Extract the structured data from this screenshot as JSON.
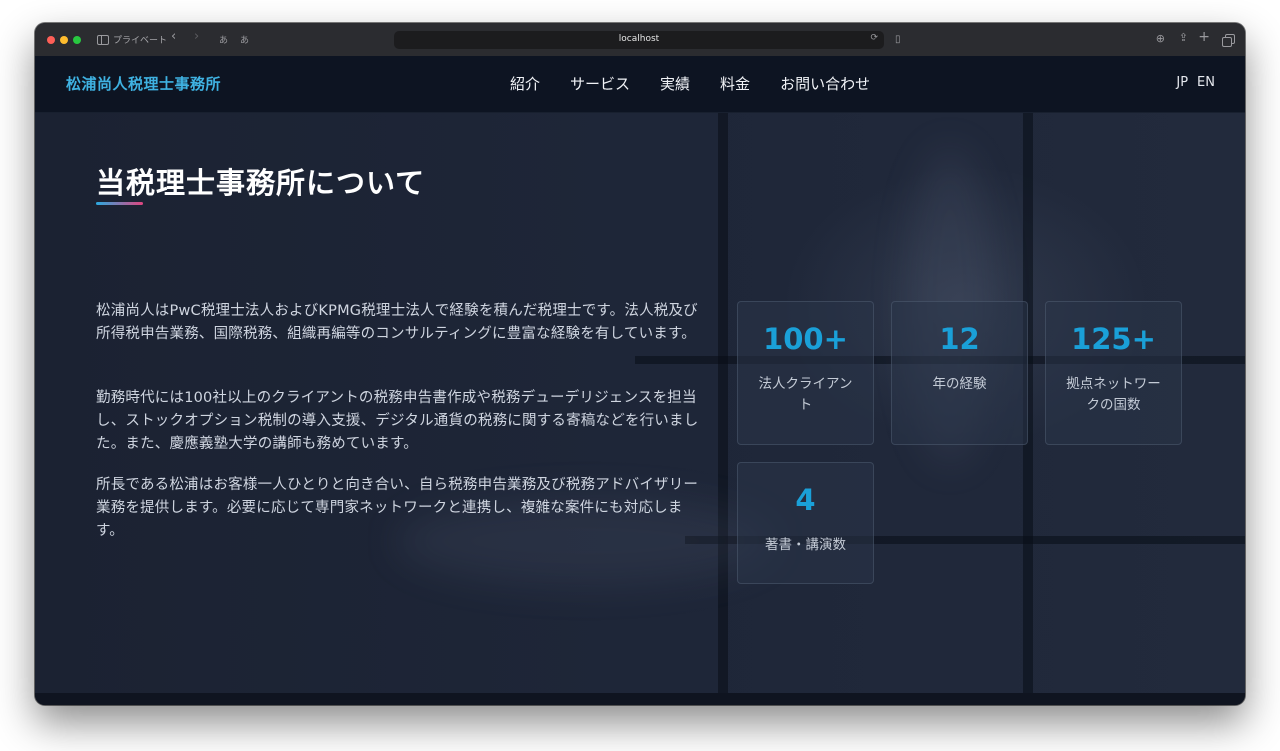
{
  "browser": {
    "private_label": "プライベート",
    "aa_label_1": "あ",
    "aa_label_2": "あ",
    "url": "localhost"
  },
  "nav": {
    "brand": "松浦尚人税理士事務所",
    "menu": [
      "紹介",
      "サービス",
      "実績",
      "料金",
      "お問い合わせ"
    ],
    "lang": [
      "JP",
      "EN"
    ]
  },
  "about": {
    "title": "当税理士事務所について",
    "paragraphs": [
      "松浦尚人はPwC税理士法人およびKPMG税理士法人で経験を積んだ税理士です。法人税及び所得税申告業務、国際税務、組織再編等のコンサルティングに豊富な経験を有しています。",
      "勤務時代には100社以上のクライアントの税務申告書作成や税務デューデリジェンスを担当し、ストックオプション税制の導入支援、デジタル通貨の税務に関する寄稿などを行いました。また、慶應義塾大学の講師も務めています。",
      "所長である松浦はお客様一人ひとりと向き合い、自ら税務申告業務及び税務アドバイザリー業務を提供します。必要に応じて専門家ネットワークと連携し、複雑な案件にも対応します。"
    ]
  },
  "stats": [
    {
      "value": "100+",
      "label": "法人クライアント"
    },
    {
      "value": "12",
      "label": "年の経験"
    },
    {
      "value": "125+",
      "label": "拠点ネットワークの国数"
    },
    {
      "value": "4",
      "label": "著書・講演数"
    }
  ],
  "colors": {
    "accent": "#1aa0d8",
    "brand": "#3fb2e2",
    "underline_start": "#2aa9e0",
    "underline_end": "#e0457f"
  }
}
